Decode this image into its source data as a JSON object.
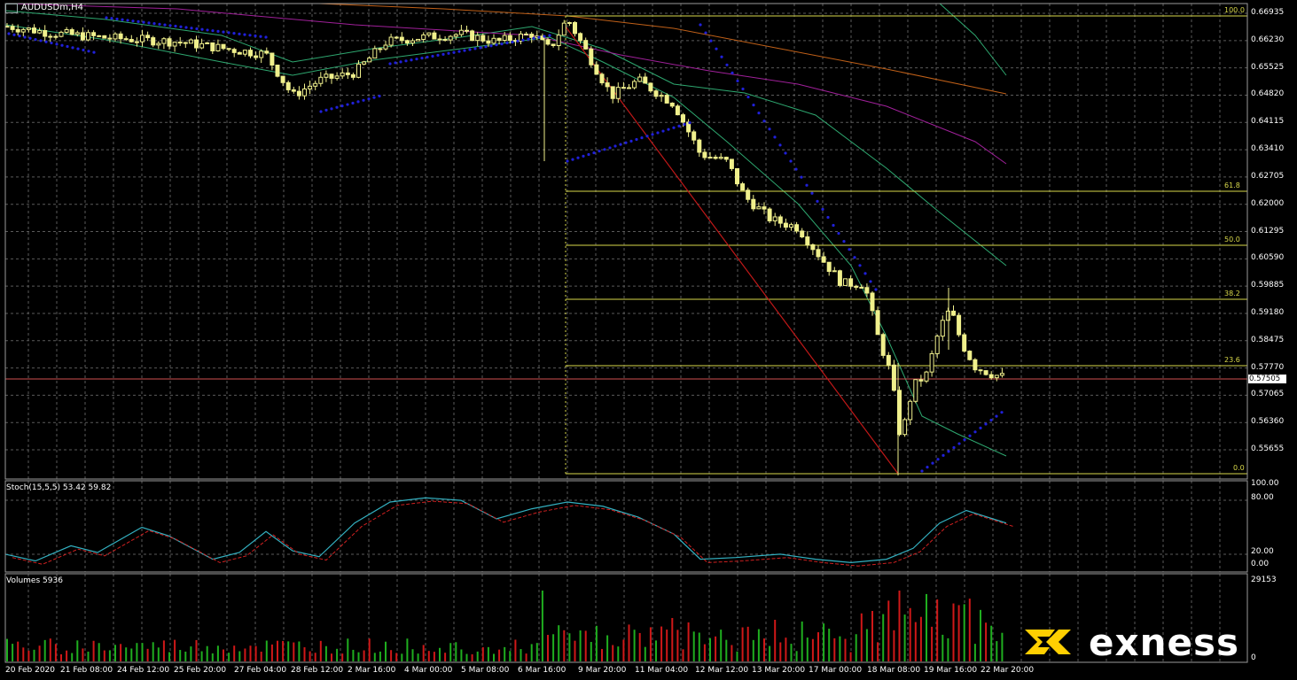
{
  "window": {
    "symbol": "AUDUSDm,H4",
    "symbol_icon": "chart-window-icon"
  },
  "price_axis": {
    "labels": [
      "0.66935",
      "0.66230",
      "0.65525",
      "0.64820",
      "0.64115",
      "0.63410",
      "0.62705",
      "0.62000",
      "0.61295",
      "0.60590",
      "0.59885",
      "0.59180",
      "0.58475",
      "0.57770",
      "0.57065",
      "0.56360",
      "0.55655"
    ],
    "current_price": "0.57505"
  },
  "fibonacci": {
    "levels": [
      "100.0",
      "61.8",
      "50.0",
      "38.2",
      "23.6",
      "0.0"
    ],
    "color": "#d8d84a"
  },
  "stochastic": {
    "title": "Stoch(15,5,5) 53.42 59.82",
    "axis_labels": [
      "100.00",
      "80.00",
      "20.00",
      "0.00"
    ],
    "main_color": "#33b0c0",
    "signal_color": "#d02020"
  },
  "volumes": {
    "title": "Volumes 5936",
    "axis_labels": [
      "29153",
      "0"
    ],
    "up_color": "#1fae1f",
    "down_color": "#d01818"
  },
  "time_axis": {
    "labels": [
      "20 Feb 2020",
      "21 Feb 08:00",
      "24 Feb 12:00",
      "25 Feb 20:00",
      "27 Feb 04:00",
      "28 Feb 12:00",
      "2 Mar 16:00",
      "4 Mar 00:00",
      "5 Mar 08:00",
      "6 Mar 16:00",
      "9 Mar 20:00",
      "11 Mar 04:00",
      "12 Mar 12:00",
      "13 Mar 20:00",
      "17 Mar 00:00",
      "18 Mar 08:00",
      "19 Mar 16:00",
      "22 Mar 20:00"
    ]
  },
  "colors": {
    "background": "#000000",
    "grid": "#5a5a5a",
    "candles": "#f0f08c",
    "parabolic_sar": "#2020d8",
    "bollinger": "#2ea870",
    "ma_purple": "#a0209a",
    "ma_orange": "#c06018",
    "trendline": "#c01818",
    "price_line": "#d05050"
  },
  "brand": {
    "name": "exness",
    "accent": "#ffcf01",
    "icon": "exness-logo-icon"
  }
}
